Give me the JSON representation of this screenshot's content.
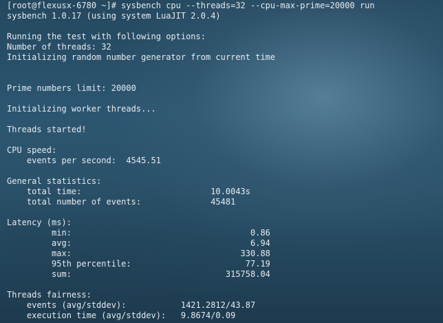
{
  "terminal": {
    "lines": [
      "[root@flexusx-6780 ~]# sysbench cpu --threads=32 --cpu-max-prime=20000 run",
      "sysbench 1.0.17 (using system LuaJIT 2.0.4)",
      "",
      "Running the test with following options:",
      "Number of threads: 32",
      "Initializing random number generator from current time",
      "",
      "",
      "Prime numbers limit: 20000",
      "",
      "Initializing worker threads...",
      "",
      "Threads started!",
      "",
      "CPU speed:",
      "    events per second:  4545.51",
      "",
      "General statistics:",
      "    total time:                          10.0043s",
      "    total number of events:              45481",
      "",
      "Latency (ms):",
      "         min:                                    0.86",
      "         avg:                                    6.94",
      "         max:                                  330.88",
      "         95th percentile:                       77.19",
      "         sum:                               315758.04",
      "",
      "Threads fairness:",
      "    events (avg/stddev):           1421.2812/43.87",
      "    execution time (avg/stddev):   9.8674/0.09"
    ]
  }
}
